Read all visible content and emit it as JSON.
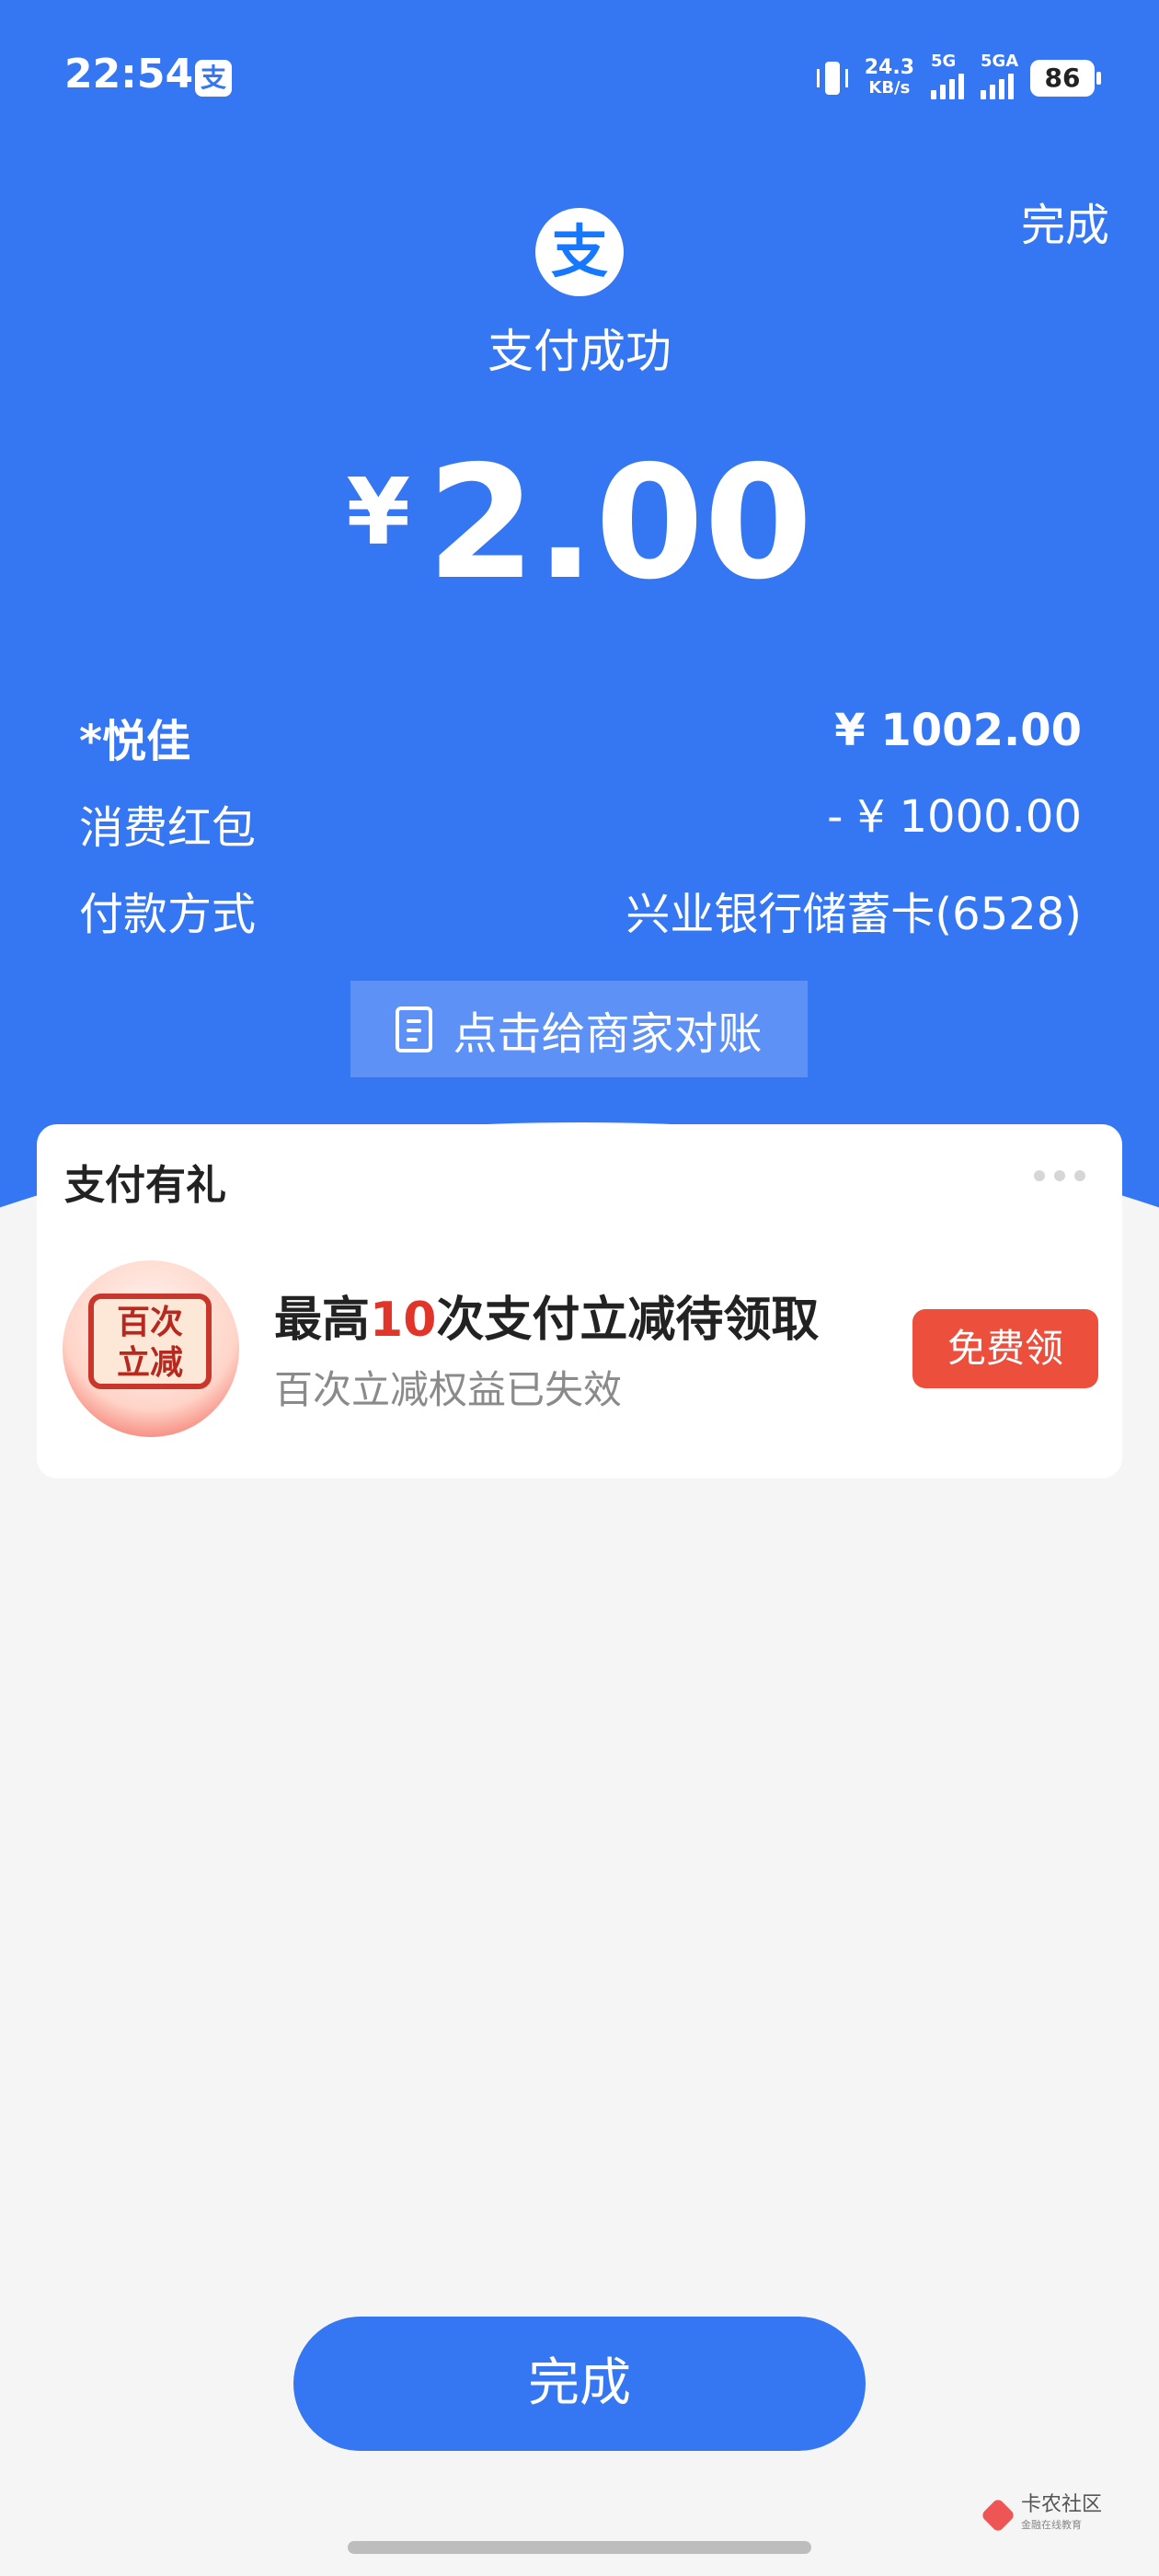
{
  "status_bar": {
    "time": "22:54",
    "app_icon_glyph": "支",
    "net_speed": "24.3",
    "net_unit": "KB/s",
    "sim1_label": "5G",
    "sim2_label": "5GA",
    "battery": "86"
  },
  "header": {
    "done_label": "完成",
    "logo_glyph": "支",
    "status_text": "支付成功",
    "currency_symbol": "¥",
    "amount": "2.00"
  },
  "details": [
    {
      "label": "*悦佳",
      "value": "¥ 1002.00"
    },
    {
      "label": "消费红包",
      "value": "- ¥ 1000.00"
    },
    {
      "label": "付款方式",
      "value": "兴业银行储蓄卡(6528)"
    }
  ],
  "reconcile_button": "点击给商家对账",
  "promo_card": {
    "title": "支付有礼",
    "badge_line1": "百次",
    "badge_line2": "立减",
    "headline_prefix": "最高",
    "headline_highlight": "10",
    "headline_suffix": "次支付立减待领取",
    "subtitle": "百次立减权益已失效",
    "button": "免费领"
  },
  "footer": {
    "done_label": "完成",
    "watermark": "卡农社区",
    "watermark_sub": "金融在线教育"
  },
  "colors": {
    "brand_blue": "#3576f3",
    "promo_red": "#ec4f3c"
  }
}
